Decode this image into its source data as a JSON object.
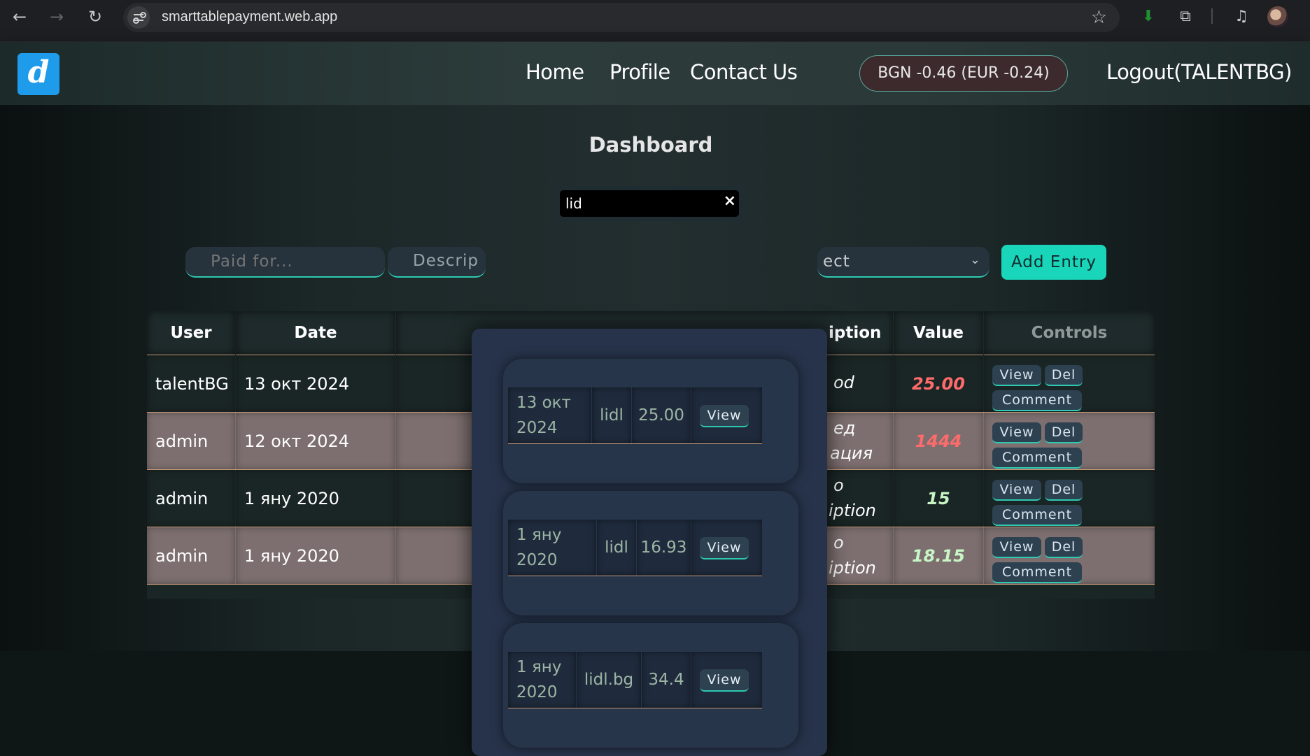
{
  "browser": {
    "url": "smarttablepayment.web.app"
  },
  "header": {
    "logo_letter": "d",
    "nav": [
      "Home",
      "Profile",
      "Contact Us"
    ],
    "balance": "BGN -0.46  (EUR -0.24)",
    "logout": "Logout(TALENTBG)"
  },
  "dashboard": {
    "title": "Dashboard",
    "search": {
      "value": "lid",
      "clear": "×"
    },
    "form": {
      "paid_for_placeholder": "Paid for...",
      "description_visible": "Descrip",
      "select_visible": "ect",
      "add_button": "Add Entry"
    },
    "table": {
      "headers": {
        "user": "User",
        "date": "Date",
        "description": "iption",
        "value": "Value",
        "controls": "Controls"
      },
      "rows": [
        {
          "user": "talentBG",
          "date": "13 окт 2024",
          "desc1": "od",
          "desc2": "",
          "value": "25.00",
          "color": "#ff6b6b"
        },
        {
          "user": "admin",
          "date": "12 окт 2024",
          "desc1": "ед",
          "desc2": "ация",
          "value": "1444",
          "color": "#ff6b6b"
        },
        {
          "user": "admin",
          "date": "1 яну 2020",
          "desc1": "o",
          "desc2": "iption",
          "value": "15",
          "color": "#c7f5c5"
        },
        {
          "user": "admin",
          "date": "1 яну 2020",
          "desc1": "o",
          "desc2": "iption",
          "value": "18.15",
          "color": "#c7f5c5"
        }
      ],
      "controls": {
        "view": "View",
        "del": "Del",
        "comment": "Comment"
      }
    },
    "results": [
      {
        "date_line1": "13 окт",
        "date_line2": "2024",
        "shop": "lidl",
        "amount": "25.00",
        "view": "View"
      },
      {
        "date_line1": "1 яну",
        "date_line2": "2020",
        "shop": "lidl",
        "amount": "16.93",
        "view": "View"
      },
      {
        "date_line1": "1 яну",
        "date_line2": "2020",
        "shop": "lidl.bg",
        "amount": "34.4",
        "view": "View"
      }
    ]
  }
}
